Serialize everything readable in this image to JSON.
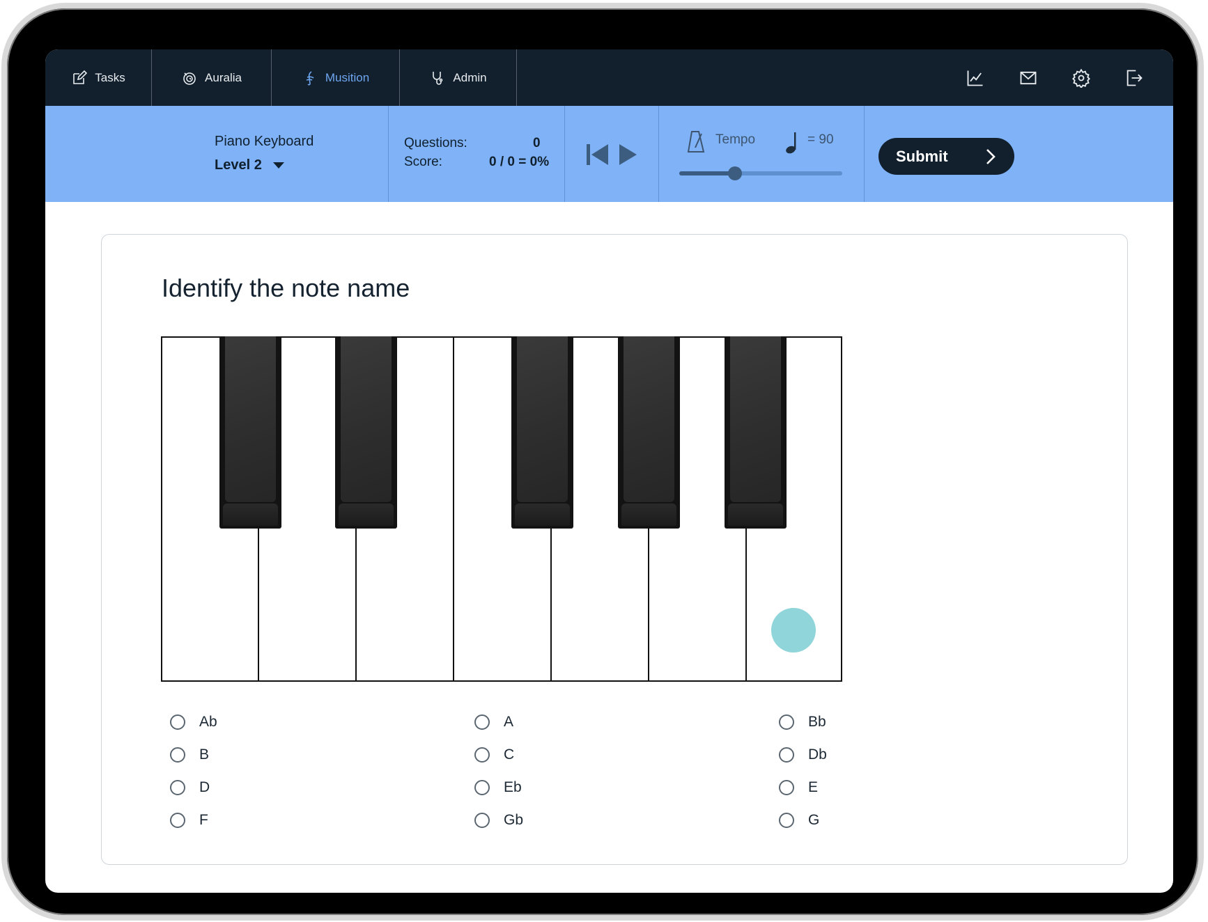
{
  "nav": {
    "tabs": [
      {
        "label": "Tasks",
        "icon": "edit-icon"
      },
      {
        "label": "Auralia",
        "icon": "auralia-swirl-icon"
      },
      {
        "label": "Musition",
        "icon": "musition-clef-icon",
        "active": true
      },
      {
        "label": "Admin",
        "icon": "stethoscope-icon"
      }
    ],
    "right_icons": [
      "chart-icon",
      "mail-icon",
      "gear-icon",
      "logout-icon"
    ]
  },
  "toolbar": {
    "topic": "Piano Keyboard",
    "level": "Level 2",
    "questions_label": "Questions:",
    "questions_value": "0",
    "score_label": "Score:",
    "score_value": "0 / 0 = 0%",
    "tempo_label": "Tempo",
    "tempo_value": "= 90",
    "tempo_level": 0.34,
    "submit_label": "Submit"
  },
  "question": {
    "title": "Identify the note name",
    "marked_key": "white key 7"
  },
  "options": [
    [
      "Ab",
      "A",
      "Bb"
    ],
    [
      "B",
      "C",
      "Db"
    ],
    [
      "D",
      "Eb",
      "E"
    ],
    [
      "F",
      "Gb",
      "G"
    ]
  ],
  "colors": {
    "nav_bg": "#12202e",
    "band_bg": "#7fb2f6",
    "active_tab": "#6fa6f0",
    "marker": "#8fd5da"
  }
}
